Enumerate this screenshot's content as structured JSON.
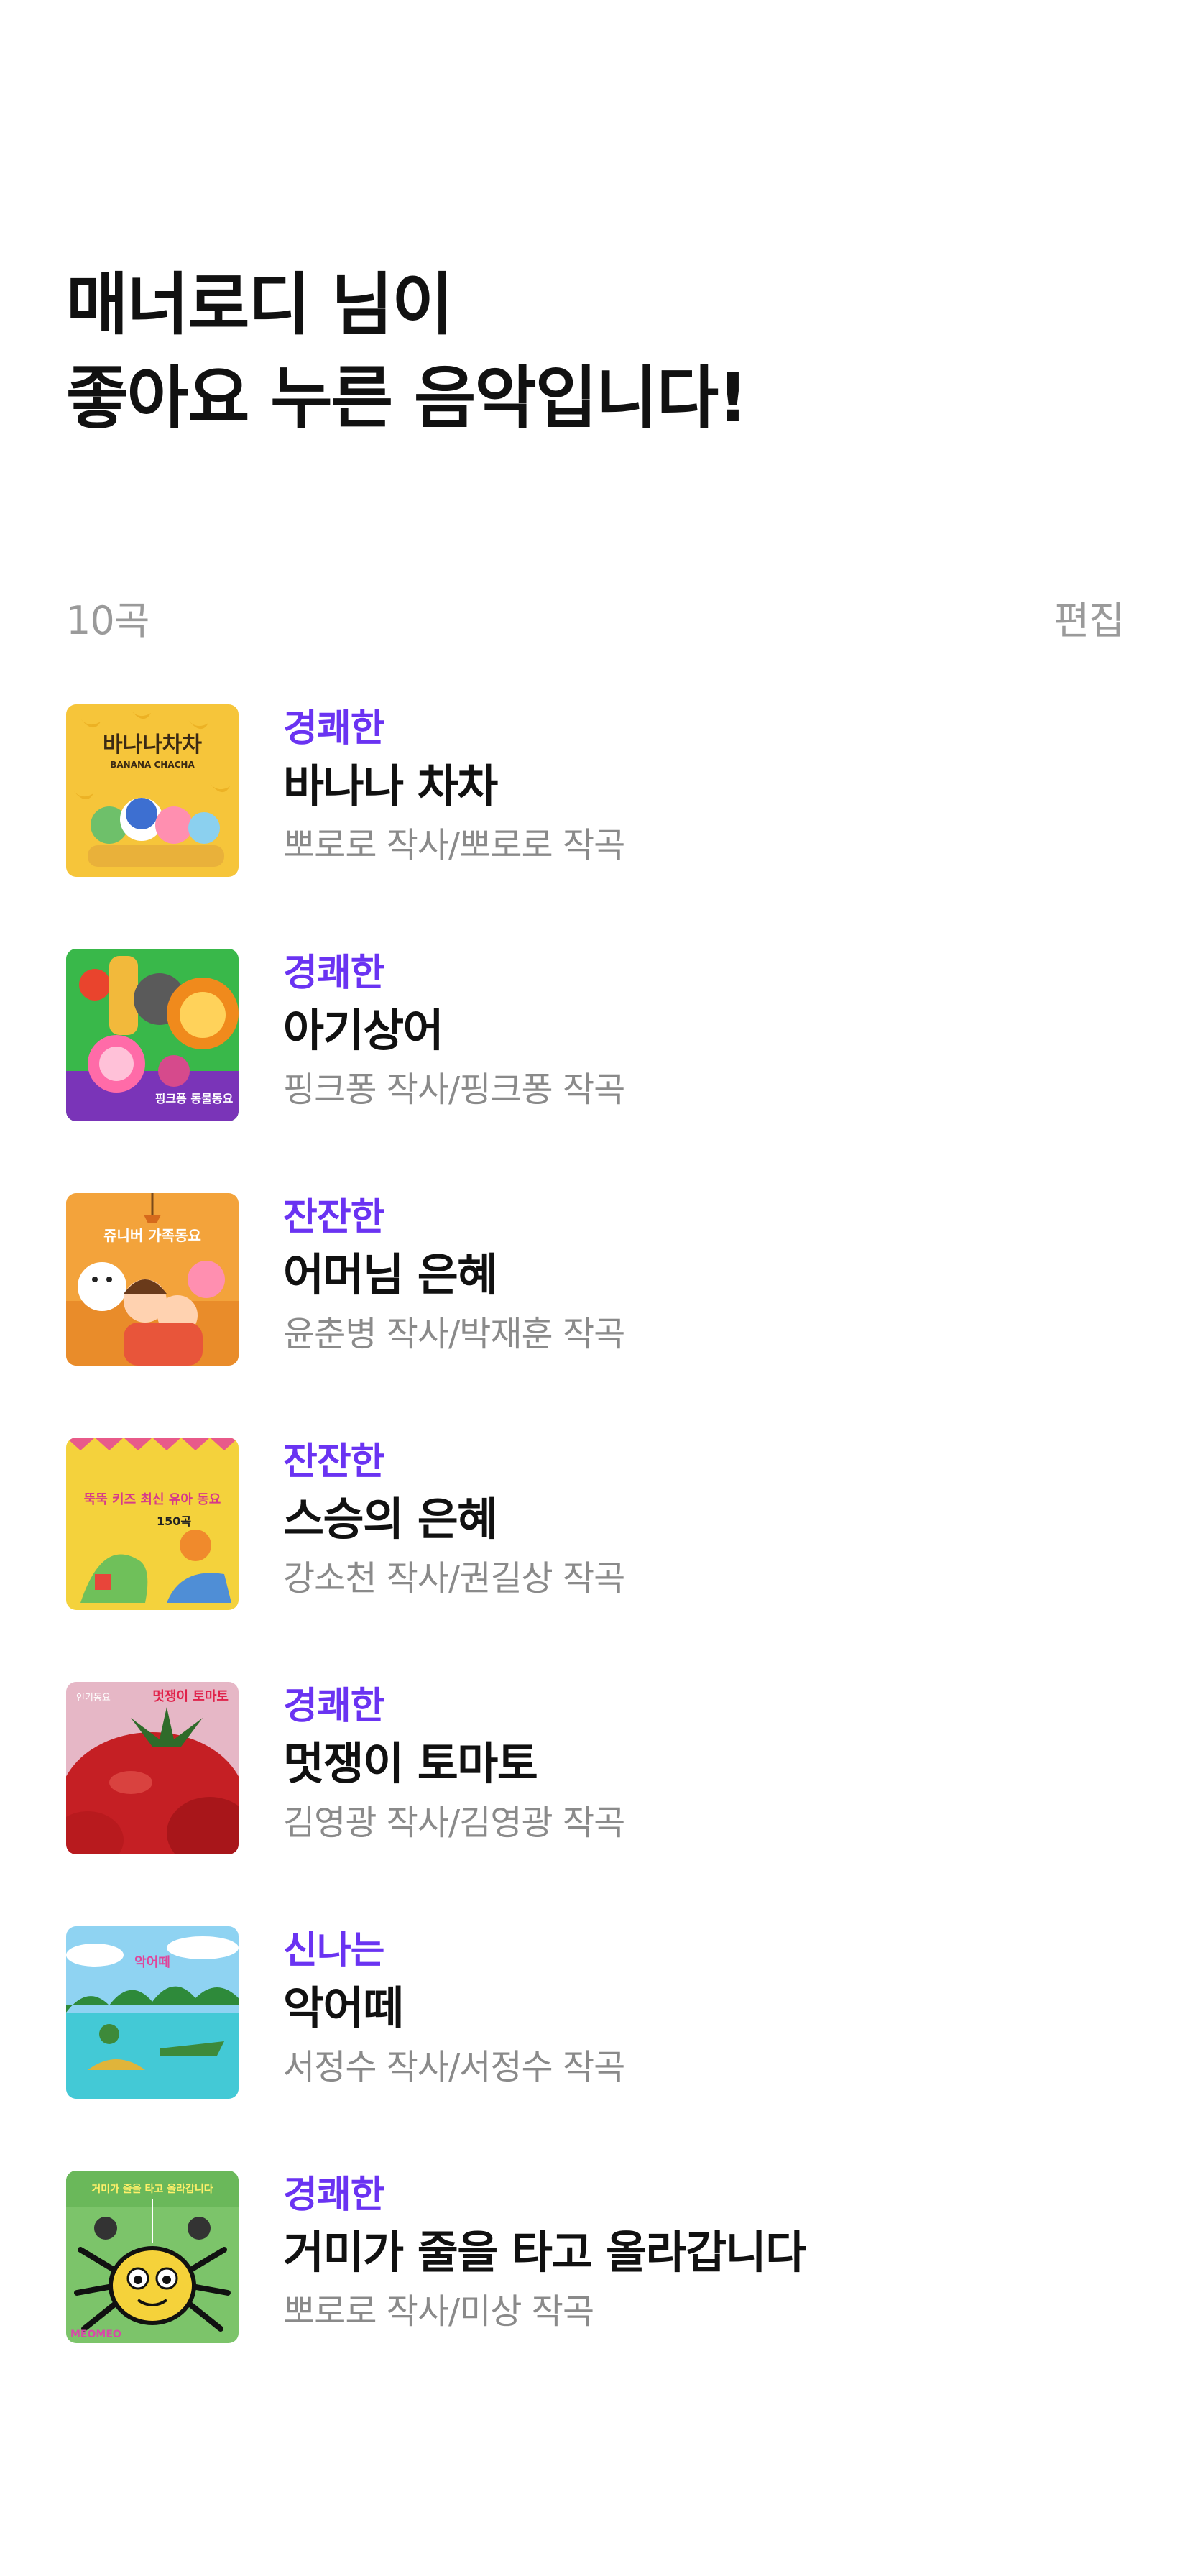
{
  "header": {
    "title_line1": "매너로디 님이",
    "title_line2": "좋아요 누른 음악입니다!"
  },
  "list_header": {
    "count": "10곡",
    "edit_label": "편집"
  },
  "colors": {
    "mood_accent": "#6a33f2",
    "secondary_text": "#8a8a8a"
  },
  "songs": [
    {
      "mood": "경쾌한",
      "title": "바나나 차차",
      "credits": "뽀로로 작사/뽀로로 작곡",
      "cover_text": "바나나차차",
      "cover_sub": "BANANA CHACHA"
    },
    {
      "mood": "경쾌한",
      "title": "아기상어",
      "credits": "핑크퐁 작사/핑크퐁 작곡",
      "cover_text": "핑크퐁 동물동요",
      "cover_sub": ""
    },
    {
      "mood": "잔잔한",
      "title": "어머님 은혜",
      "credits": "윤춘병 작사/박재훈 작곡",
      "cover_text": "쥬니버 가족동요",
      "cover_sub": ""
    },
    {
      "mood": "잔잔한",
      "title": "스승의 은혜",
      "credits": "강소천 작사/권길상 작곡",
      "cover_text": "뚝뚝 키즈 최신 유아 동요",
      "cover_sub": "150곡"
    },
    {
      "mood": "경쾌한",
      "title": "멋쟁이 토마토",
      "credits": "김영광 작사/김영광 작곡",
      "cover_text": "멋쟁이 토마토",
      "cover_sub": "인기동요"
    },
    {
      "mood": "신나는",
      "title": "악어떼",
      "credits": "서정수 작사/서정수 작곡",
      "cover_text": "악어떼",
      "cover_sub": ""
    },
    {
      "mood": "경쾌한",
      "title": "거미가 줄을 타고 올라갑니다",
      "credits": "뽀로로 작사/미상 작곡",
      "cover_text": "거미가 줄을 타고 올라갑니다",
      "cover_sub": "MEOMEO"
    }
  ]
}
